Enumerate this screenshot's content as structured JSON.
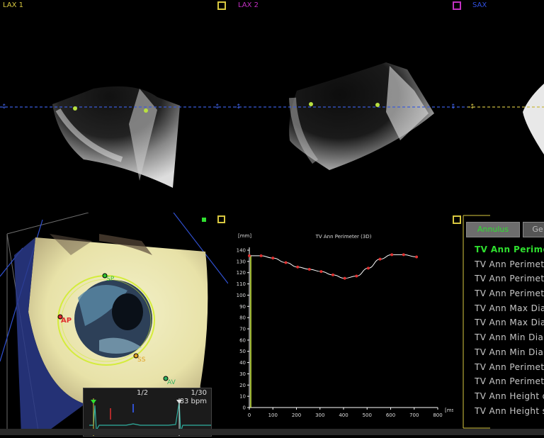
{
  "views": {
    "lax1": {
      "label": "LAX 1",
      "color": "#d8c840"
    },
    "lax2": {
      "label": "LAX 2",
      "color": "#c030c0"
    },
    "sax": {
      "label": "SAX",
      "color": "#3050e0"
    }
  },
  "volume_view": {
    "markers": {
      "ap": "AP",
      "sp": "SP",
      "ss": "SS",
      "av": "AV"
    }
  },
  "ecg": {
    "frame": "1/2",
    "frame_total": "1/30",
    "heart_rate": "83 bpm"
  },
  "tabs": [
    {
      "label": "Annulus",
      "active": true
    },
    {
      "label": "Ge",
      "active": false
    }
  ],
  "measurements": [
    {
      "label": "TV Ann Perimeter",
      "active": true
    },
    {
      "label": "TV Ann Perimeter",
      "active": false
    },
    {
      "label": "TV Ann Perimeter",
      "active": false
    },
    {
      "label": "TV Ann Perimeter",
      "active": false
    },
    {
      "label": "TV Ann Max Diam",
      "active": false
    },
    {
      "label": "TV Ann Max Diam",
      "active": false
    },
    {
      "label": "TV Ann Min Diam",
      "active": false
    },
    {
      "label": "TV Ann Min Diam",
      "active": false
    },
    {
      "label": "TV Ann Perimeter",
      "active": false
    },
    {
      "label": "TV Ann Perimeter",
      "active": false
    },
    {
      "label": "TV Ann Height di",
      "active": false
    },
    {
      "label": "TV Ann Height sy",
      "active": false
    }
  ],
  "chart_data": {
    "type": "line",
    "title": "TV Ann Perimeter (3D)",
    "ylabel": "[mm]",
    "xlabel": "[ms]",
    "xlim": [
      0,
      800
    ],
    "ylim": [
      0,
      140
    ],
    "xticks": [
      0,
      100,
      200,
      300,
      400,
      500,
      600,
      700,
      800
    ],
    "yticks": [
      0,
      10,
      20,
      30,
      40,
      50,
      60,
      70,
      80,
      90,
      100,
      110,
      120,
      130,
      140
    ],
    "grid": false,
    "series": [
      {
        "x": [
          0,
          50,
          100,
          155,
          205,
          255,
          305,
          355,
          405,
          455,
          505,
          555,
          605,
          655,
          710
        ],
        "y": [
          135,
          135,
          133,
          129,
          125,
          123,
          121,
          118,
          115,
          117,
          124,
          132,
          136,
          136,
          134
        ]
      }
    ],
    "colors": {
      "line": "#ffffff",
      "points": "#e03030",
      "axis": "#ffffff",
      "cursor": "#d0f040"
    }
  }
}
